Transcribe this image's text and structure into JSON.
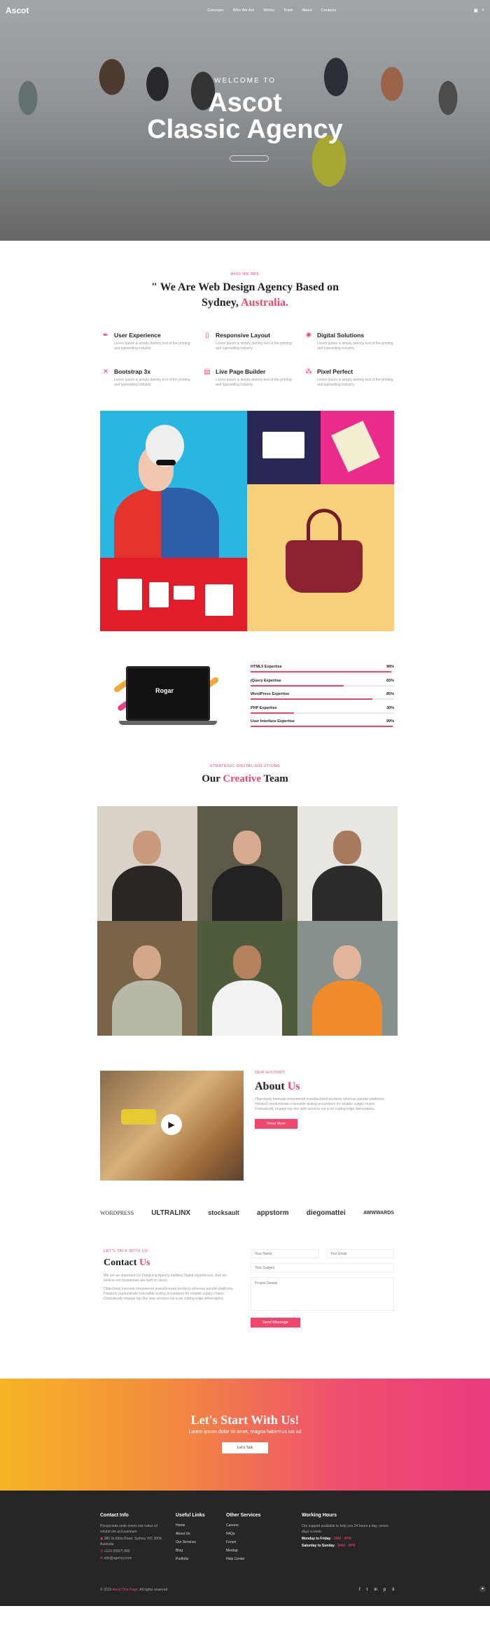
{
  "nav": {
    "logo": "Ascot",
    "menu": [
      "Concepts",
      "Who We Are",
      "Works",
      "Team",
      "About",
      "Contacts"
    ]
  },
  "hero": {
    "welcome": "WELCOME TO",
    "title_line1": "Ascot",
    "title_line2": "Classic Agency"
  },
  "who": {
    "eyebrow": "WHO WE ARE",
    "heading_prefix": "\" We Are Web Design Agency Based on Sydney, ",
    "heading_accent": "Australia.",
    "features": [
      {
        "icon": "pen-icon",
        "glyph": "✒",
        "title": "User Experience",
        "text": "Lorem Ipsum is simply dummy text of the printing and typesetting industry."
      },
      {
        "icon": "mobile-icon",
        "glyph": "▯",
        "title": "Responsive Layout",
        "text": "Lorem Ipsum is simply dummy text of the printing and typesetting industry."
      },
      {
        "icon": "bulb-icon",
        "glyph": "✺",
        "title": "Digital Solutions",
        "text": "Lorem Ipsum is simply dummy text of the printing and typesetting industry."
      },
      {
        "icon": "tools-icon",
        "glyph": "✕",
        "title": "Bootstrap 3x",
        "text": "Lorem Ipsum is simply dummy text of the printing and typesetting industry."
      },
      {
        "icon": "page-builder-icon",
        "glyph": "▤",
        "title": "Live Page Builder",
        "text": "Lorem Ipsum is simply dummy text of the printing and typesetting industry."
      },
      {
        "icon": "pixel-icon",
        "glyph": "⁂",
        "title": "Pixel Perfect",
        "text": "Lorem Ipsum is simply dummy text of the printing and typesetting industry."
      }
    ]
  },
  "skills": {
    "laptop_text": "Rogar",
    "items": [
      {
        "label": "HTML5 Expertise",
        "value": "98%",
        "level": 0.98
      },
      {
        "label": "jQuery Expertise",
        "value": "65%",
        "level": 0.65
      },
      {
        "label": "WordPress Expertise",
        "value": "85%",
        "level": 0.85
      },
      {
        "label": "PHP Expertise",
        "value": "30%",
        "level": 0.3
      },
      {
        "label": "User Interface Expertise",
        "value": "99%",
        "level": 0.99
      }
    ]
  },
  "team": {
    "eyebrow": "STRATEGIC DIGITAL SOLUTIONS",
    "heading_prefix": "Our ",
    "heading_accent": "Creative",
    "heading_suffix": " Team"
  },
  "about": {
    "eyebrow": "OUR HISTORY",
    "heading_prefix": "About ",
    "heading_accent": "Us",
    "text": "Objectively innovate empowered manufactured products whereas parallel platforms. Holisticly predominate extensible testing procedures for reliable supply chains. Dramatically engage top-line web services vis-a-vis cutting-edge deliverables.",
    "button": "Read More"
  },
  "clients": [
    "WORDPRESS",
    "ULTRALINX",
    "stocksault",
    "appstorm",
    "diegomattei",
    "AWWWARDS"
  ],
  "contact": {
    "eyebrow": "LET'S TALK WITH US",
    "heading_prefix": "Contact ",
    "heading_accent": "Us",
    "text1": "We are an Important Us Designing Agency building Digital experiences. And we believe our businesses are built on ideas.",
    "text2": "Objectively innovate empowered manufactured products whereas parallel platforms. Holisticly predominate extensible testing procedures for reliable supply chains. Dramatically engage top-line web services vis-a-vis cutting-edge deliverables.",
    "name_placeholder": "Your Name",
    "email_placeholder": "Your Email",
    "subject_placeholder": "Your Subject",
    "details_placeholder": "Project Details",
    "button": "Send Message"
  },
  "cta": {
    "title": "Let's Start With Us!",
    "subtitle": "Lorem ipsum dolor sit amet, magna habemus ius ad",
    "button": "Let's Talk"
  },
  "footer": {
    "contact_title": "Contact Info",
    "contact_text": "Perspiciatis unde omnis iste natus sit volutat em accusantium",
    "address": "380 St Kilda Road, Sydney VIC 3004, Australia",
    "phone": "+123 (4567) 890",
    "email": "info@agency.com",
    "useful_title": "Useful Links",
    "useful": [
      "Home",
      "About Us",
      "Our Services",
      "Blog",
      "Portfolio"
    ],
    "other_title": "Other Services",
    "other": [
      "Careers",
      "FAQs",
      "Forum",
      "Meetup",
      "Help Center"
    ],
    "hours_title": "Working Hours",
    "hours_text": "Our support available to help you 24 hours a day, seven days a week.",
    "hours1_label": "Monday to Friday",
    "hours1_value": " - 9AM - 5PM",
    "hours2_label": "Saturday to Sunday",
    "hours2_value": " - 9AM - 3PM",
    "copyright_prefix": "© 2019 ",
    "copyright_accent": "Ascot One Page",
    "copyright_suffix": ". All rights reserved",
    "social": [
      "f",
      "t",
      "in",
      "p",
      "li"
    ]
  },
  "colors": {
    "accent": "#f0466e",
    "footer_bg": "#262626"
  }
}
